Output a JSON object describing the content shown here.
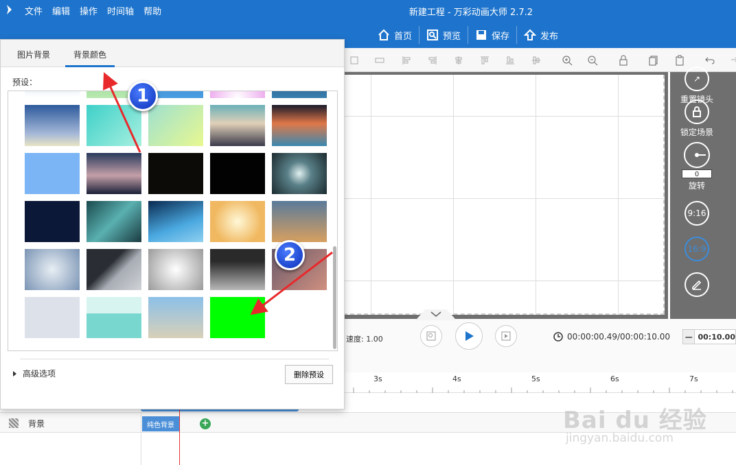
{
  "app": {
    "window_title": "新建工程 - 万彩动画大师 2.7.2",
    "menu": [
      "文件",
      "编辑",
      "操作",
      "时间轴",
      "帮助"
    ]
  },
  "topnav": [
    {
      "label": "首页",
      "icon": "home-icon"
    },
    {
      "label": "预览",
      "icon": "preview-icon"
    },
    {
      "label": "保存",
      "icon": "save-icon"
    },
    {
      "label": "发布",
      "icon": "publish-icon"
    }
  ],
  "right_panel": {
    "reset_camera": "重置镜头",
    "lock_scene": "锁定场景",
    "rotate": "旋转",
    "rotation_value": "0",
    "ratio_916": "9:16",
    "ratio_169": "16:9"
  },
  "playback": {
    "speed": "速度: 1.00",
    "time": "00:00:00.49/00:00:10.00",
    "duration": "00:10.00"
  },
  "timeline": {
    "ticks": [
      "3s",
      "4s",
      "5s",
      "6s",
      "7s"
    ],
    "track_label": "背景",
    "clip_label": "纯色背景"
  },
  "panel": {
    "tab_image_bg": "图片背景",
    "tab_bg_color": "背景颜色",
    "preset_label": "预设：",
    "advanced_options": "高级选项",
    "delete_preset": "删除预设"
  },
  "annotations": {
    "badge_1": "1",
    "badge_2": "2",
    "accent_color": "#e8292c",
    "badge_color": "#1a4fd6"
  },
  "watermark": {
    "brand": "Bai du 经验",
    "url": "jingyan.baidu.com"
  },
  "colors": {
    "topbar": "#1e74cc",
    "stage": "#6f6f6f",
    "selected_swatch": "#00ff00"
  }
}
